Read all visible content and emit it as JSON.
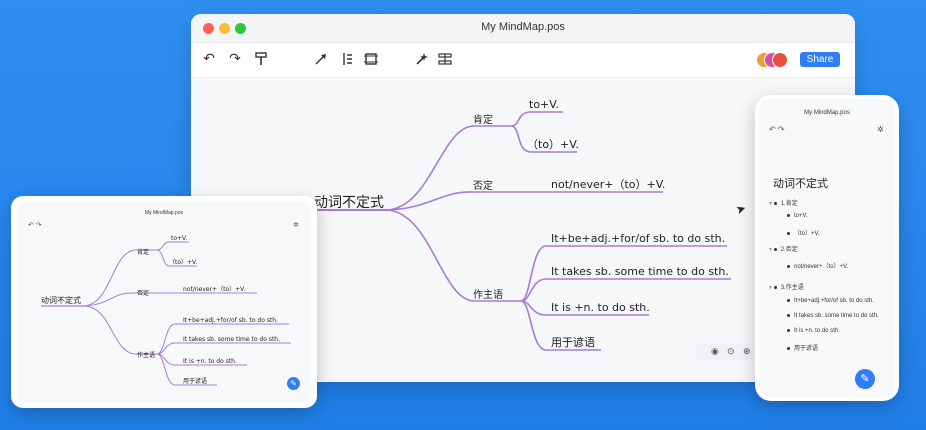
{
  "colors": {
    "background": "#1f7fe8",
    "branch": "#a77bd8",
    "accent": "#2f7ef5"
  },
  "app": {
    "title": "My MindMap.pos",
    "share_label": "Share",
    "toolbar_icons": [
      "undo-icon",
      "redo-icon",
      "format-painter-icon",
      "pointer-icon",
      "layout-icon",
      "frame-icon",
      "magic-wand-icon",
      "outline-icon"
    ],
    "zoom_icons": [
      "eye-icon",
      "target-icon",
      "zoom-icon"
    ]
  },
  "mindmap": {
    "root": "动词不定式",
    "branches": [
      {
        "label": "肯定",
        "children": [
          "to+V.",
          "（to）+V."
        ]
      },
      {
        "label": "否定",
        "children": [
          "not/never+（to）+V."
        ]
      },
      {
        "label": "作主语",
        "children": [
          "It+be+adj.+for/of sb. to do sth.",
          "It takes sb. some time to do sth.",
          "It is +n. to do sth.",
          "用于谚语"
        ]
      }
    ]
  },
  "tablet": {
    "title": "My MindMap.pos",
    "root": "动词不定式",
    "b1": "肯定",
    "b1c1": "to+V.",
    "b1c2": "（to）+V.",
    "b2": "否定",
    "b2c1": "not/never+（to）+V.",
    "b3": "作主语",
    "b3c1": "It+be+adj.+for/of sb. to do sth.",
    "b3c2": "It takes sb. some time to do sth.",
    "b3c3": "It is +n. to do sth.",
    "b3c4": "用于谚语"
  },
  "phone": {
    "title": "My MindMap.pos",
    "root": "动词不定式",
    "outline": [
      {
        "level": 1,
        "text": "1.肯定"
      },
      {
        "level": 2,
        "text": "to+V."
      },
      {
        "level": 2,
        "text": "（to）+V."
      },
      {
        "level": 1,
        "text": "2.否定"
      },
      {
        "level": 2,
        "text": "not/never+（to）+V."
      },
      {
        "level": 1,
        "text": "3.作主语"
      },
      {
        "level": 2,
        "text": "It+be+adj.+for/of sb. to do sth."
      },
      {
        "level": 2,
        "text": "It takes sb. some time to do sth."
      },
      {
        "level": 2,
        "text": "It is +n. to do sth."
      },
      {
        "level": 2,
        "text": "用于谚语"
      }
    ]
  }
}
